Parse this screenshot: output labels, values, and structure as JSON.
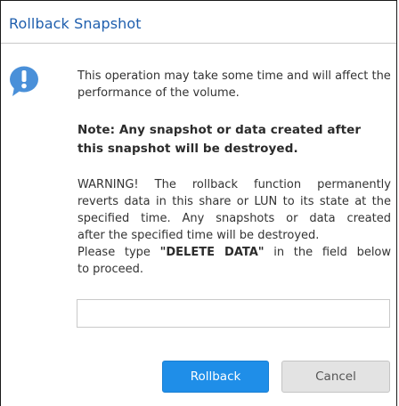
{
  "dialog": {
    "title": "Rollback Snapshot",
    "info_text": "This operation may take some time and will affect the performance of the volume.",
    "note_text": "Note: Any snapshot or data created after this snapshot will be destroyed.",
    "warning_lines": [
      "WARNING! The rollback function permanently",
      "reverts data in this share or LUN to its state at the",
      "specified time. Any snapshots or data created",
      "after the specified time will be destroyed."
    ],
    "type_prefix": "Please type ",
    "type_keyword": "\"DELETE DATA\"",
    "type_suffix_line1": " in the field below",
    "type_suffix_line2": "to proceed.",
    "input_value": "",
    "input_placeholder": "",
    "rollback_label": "Rollback",
    "cancel_label": "Cancel"
  },
  "colors": {
    "title": "#1f5fae",
    "icon": "#4a90d9",
    "primary_button": "#1f8ee8",
    "secondary_button": "#e3e3e3"
  },
  "icons": {
    "info": "exclamation-speech-bubble-icon"
  }
}
